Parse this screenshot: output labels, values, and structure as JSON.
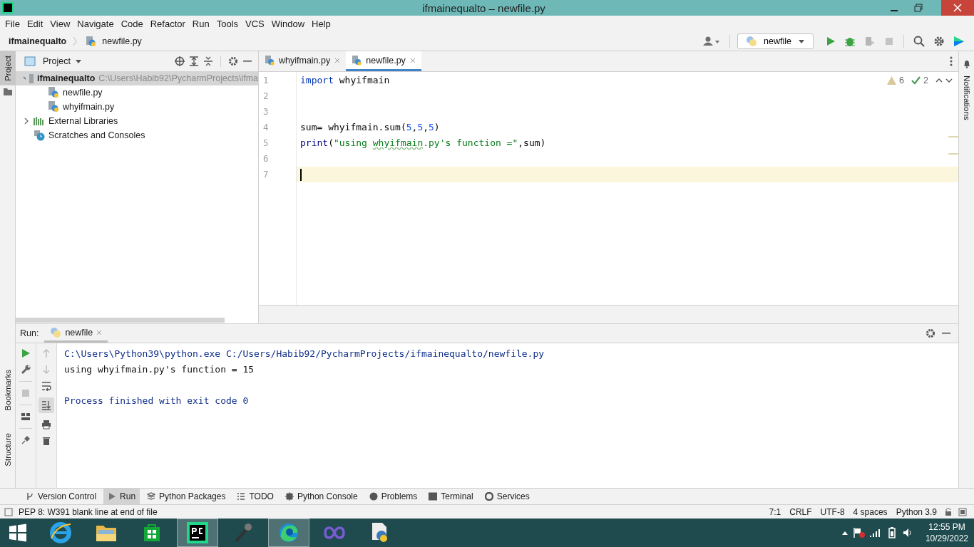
{
  "window": {
    "title": "ifmainequalto – newfile.py"
  },
  "menu": [
    "File",
    "Edit",
    "View",
    "Navigate",
    "Code",
    "Refactor",
    "Run",
    "Tools",
    "VCS",
    "Window",
    "Help"
  ],
  "breadcrumb": [
    "ifmainequalto",
    "newfile.py"
  ],
  "run_config": "newfile",
  "left_tool_windows": {
    "top": [
      {
        "label": "Project",
        "selected": true
      }
    ],
    "bottom": [
      {
        "label": "Bookmarks",
        "selected": false
      },
      {
        "label": "Structure",
        "selected": false
      }
    ]
  },
  "right_tool_windows": [
    {
      "label": "Notifications"
    }
  ],
  "project_panel": {
    "title": "Project",
    "tree": [
      {
        "name": "ifmainequalto",
        "path": "C:\\Users\\Habib92\\PycharmProjects\\ifma",
        "kind": "folder",
        "expanded": true,
        "selected": true,
        "children": [
          {
            "name": "newfile.py",
            "kind": "python",
            "selected": false
          },
          {
            "name": "whyifmain.py",
            "kind": "python",
            "selected": false
          }
        ]
      },
      {
        "name": "External Libraries",
        "kind": "library",
        "expanded": false,
        "selected": false
      },
      {
        "name": "Scratches and Consoles",
        "kind": "scratches",
        "selected": false
      }
    ]
  },
  "editor": {
    "tabs": [
      {
        "label": "whyifmain.py",
        "selected": false
      },
      {
        "label": "newfile.py",
        "selected": true
      }
    ],
    "warnings": "6",
    "weak_warnings": "2",
    "lines": [
      {
        "number": "1",
        "current": false,
        "tokens": [
          {
            "text": "import",
            "kind": "keyword"
          },
          {
            "text": " whyifmain",
            "kind": "plain"
          }
        ]
      },
      {
        "number": "2",
        "current": false
      },
      {
        "number": "3",
        "current": false
      },
      {
        "number": "4",
        "current": false,
        "tokens": [
          {
            "text": "sum= whyifmain.sum(",
            "kind": "plain"
          },
          {
            "text": "5",
            "kind": "number"
          },
          {
            "text": ",",
            "kind": "plain"
          },
          {
            "text": "5",
            "kind": "number"
          },
          {
            "text": ",",
            "kind": "plain"
          },
          {
            "text": "5",
            "kind": "number"
          },
          {
            "text": ")",
            "kind": "plain"
          }
        ]
      },
      {
        "number": "5",
        "current": false,
        "tokens": [
          {
            "text": "print",
            "kind": "builtin"
          },
          {
            "text": "(",
            "kind": "plain"
          },
          {
            "text": "\"using ",
            "kind": "string"
          },
          {
            "text": "whyifmain",
            "kind": "typo"
          },
          {
            "text": ".py's function =\"",
            "kind": "string"
          },
          {
            "text": ",sum)",
            "kind": "plain"
          }
        ]
      },
      {
        "number": "6",
        "current": false
      },
      {
        "number": "7",
        "current": true
      }
    ]
  },
  "run_panel": {
    "label": "Run:",
    "tab": "newfile",
    "output_blocks": [
      {
        "lines": [
          {
            "kind": "system",
            "text": "C:\\Users\\Python39\\python.exe C:/Users/Habib92/PycharmProjects/ifmainequalto/newfile.py"
          },
          {
            "kind": "stdout",
            "text": "using whyifmain.py's function = 15"
          }
        ]
      },
      {
        "lines": [
          {
            "kind": "system",
            "text": "Process finished with exit code 0"
          }
        ]
      }
    ]
  },
  "tool_tabs": [
    {
      "label": "Version Control",
      "kind": "vcs",
      "selected": false
    },
    {
      "label": "Run",
      "kind": "run",
      "selected": true
    },
    {
      "label": "Python Packages",
      "kind": "packages",
      "selected": false
    },
    {
      "label": "TODO",
      "kind": "todo",
      "selected": false
    },
    {
      "label": "Python Console",
      "kind": "console",
      "selected": false
    },
    {
      "label": "Problems",
      "kind": "problems",
      "selected": false
    },
    {
      "label": "Terminal",
      "kind": "terminal",
      "selected": false
    },
    {
      "label": "Services",
      "kind": "services",
      "selected": false
    }
  ],
  "status_bar": {
    "message": "PEP 8: W391 blank line at end of file",
    "items": [
      "7:1",
      "CRLF",
      "UTF-8",
      "4 spaces",
      "Python 3.9"
    ]
  },
  "taskbar": {
    "apps": [
      {
        "kind": "ie",
        "selected": false
      },
      {
        "kind": "explorer",
        "selected": false
      },
      {
        "kind": "store",
        "selected": false
      },
      {
        "kind": "pycharm",
        "selected": true
      },
      {
        "kind": "microphone",
        "selected": false
      },
      {
        "kind": "edge",
        "selected": true
      },
      {
        "kind": "infinity",
        "selected": false
      },
      {
        "kind": "python-doc",
        "selected": false
      }
    ],
    "time": "12:55 PM",
    "date": "10/29/2022"
  }
}
